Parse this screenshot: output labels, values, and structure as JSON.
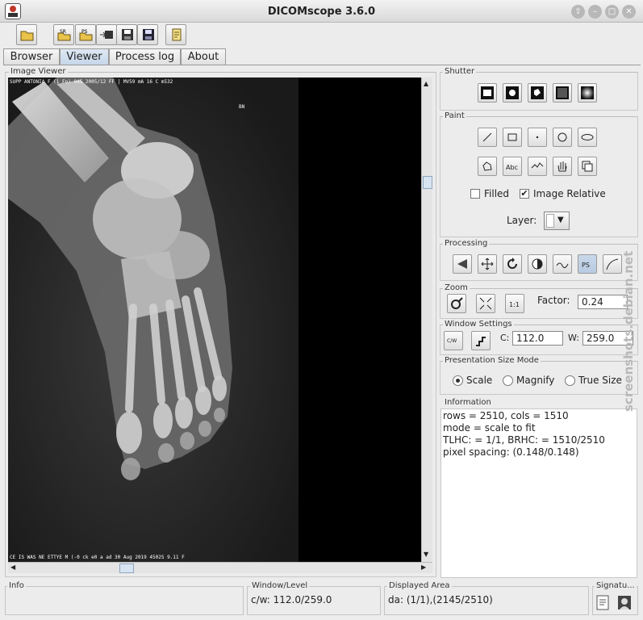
{
  "window": {
    "title": "DICOMscope 3.6.0"
  },
  "tabs": [
    {
      "label": "Browser"
    },
    {
      "label": "Viewer"
    },
    {
      "label": "Process log"
    },
    {
      "label": "About"
    }
  ],
  "viewer": {
    "group_label": "Image Viewer",
    "overlay_top": "SUPP ANTONIA        F  (1 Fo) 945        2005/12        FF   | MV59 mA 16 C m532",
    "overlay_bn": "BN",
    "overlay_bottom": "CE IS   WAS NE ETTYE     M (-0 ck e0 a ad       30 Aug 2019   4502S     9.11 F"
  },
  "shutter": {
    "label": "Shutter"
  },
  "paint": {
    "label": "Paint",
    "filled_label": "Filled",
    "filled_checked": false,
    "image_relative_label": "Image Relative",
    "image_relative_checked": true,
    "layer_label": "Layer:"
  },
  "processing": {
    "label": "Processing"
  },
  "zoom": {
    "label": "Zoom",
    "factor_label": "Factor:",
    "factor_value": "0.24"
  },
  "window_settings": {
    "label": "Window Settings",
    "c_label": "C:",
    "c_value": "112.0",
    "w_label": "W:",
    "w_value": "259.0"
  },
  "presentation": {
    "label": "Presentation Size Mode",
    "options": [
      "Scale",
      "Magnify",
      "True Size"
    ],
    "selected": "Scale"
  },
  "information": {
    "label": "Information",
    "lines": [
      "rows = 2510, cols = 1510",
      "mode = scale to fit",
      "TLHC: = 1/1, BRHC: = 1510/2510",
      "pixel spacing: (0.148/0.148)"
    ]
  },
  "status": {
    "info_label": "Info",
    "wl_label": "Window/Level",
    "wl_value": "c/w: 112.0/259.0",
    "da_label": "Displayed Area",
    "da_value": "da: (1/1),(2145/2510)",
    "sig_label": "Signatu..."
  },
  "watermark": "screenshots.debian.net",
  "colors": {
    "accent_tab": "#c6d7ea",
    "viewer_bg": "#000000"
  }
}
